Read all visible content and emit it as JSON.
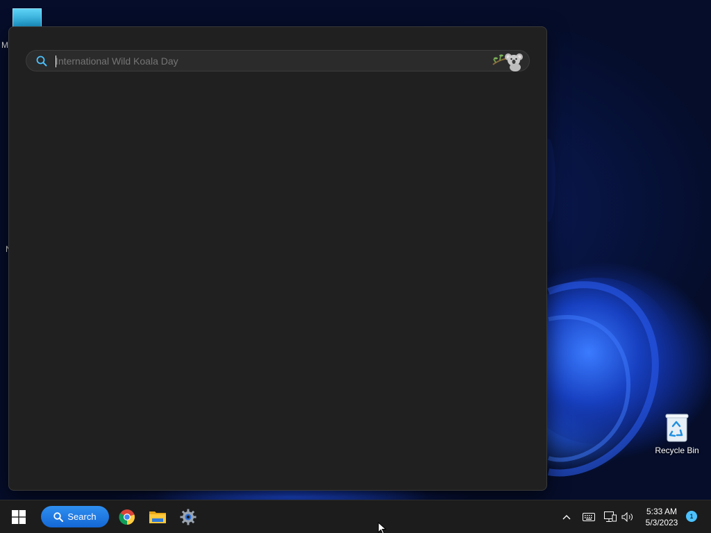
{
  "desktop": {
    "edge_letters": [
      "M",
      "N"
    ],
    "recycle_bin_label": "Recycle Bin"
  },
  "search_panel": {
    "query": "International Wild Koala Day",
    "search_icon": "search-icon",
    "doodle_icon": "koala-icon"
  },
  "taskbar": {
    "start_icon": "windows-start-icon",
    "search_label": "Search",
    "apps": [
      {
        "name": "Google Chrome",
        "icon": "chrome-icon"
      },
      {
        "name": "File Explorer",
        "icon": "folder-icon"
      },
      {
        "name": "Settings",
        "icon": "gear-icon"
      }
    ],
    "tray": {
      "chevron_icon": "chevron-up-icon",
      "keyboard_icon": "keyboard-icon",
      "network_icon": "network-icon",
      "volume_icon": "volume-icon"
    },
    "clock": {
      "time": "5:33 AM",
      "date": "5/3/2023"
    },
    "notification_count": "1"
  },
  "colors": {
    "accent": "#1a73e8",
    "panel_bg": "#202020",
    "taskbar_bg": "#1c1c1c"
  }
}
